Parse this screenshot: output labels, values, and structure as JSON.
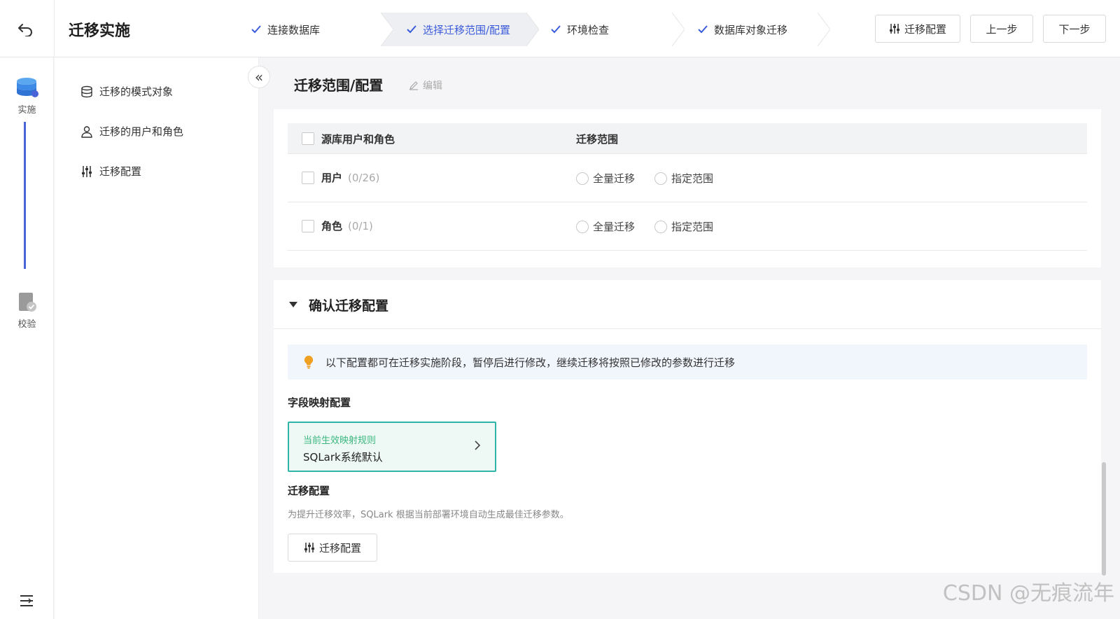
{
  "header": {
    "title": "迁移实施",
    "steps": [
      {
        "label": "连接数据库",
        "status": "done"
      },
      {
        "label": "选择迁移范围/配置",
        "status": "active"
      },
      {
        "label": "环境检查",
        "status": "done"
      },
      {
        "label": "数据库对象迁移",
        "status": "done"
      }
    ],
    "buttons": {
      "config": "迁移配置",
      "prev": "上一步",
      "next": "下一步"
    }
  },
  "rail": {
    "items": [
      {
        "label": "实施",
        "icon": "database-stack-icon"
      },
      {
        "label": "校验",
        "icon": "verify-doc-icon"
      }
    ]
  },
  "subnav": {
    "items": [
      {
        "label": "迁移的模式对象",
        "icon": "database-icon"
      },
      {
        "label": "迁移的用户和角色",
        "icon": "user-icon"
      },
      {
        "label": "迁移配置",
        "icon": "sliders-icon"
      }
    ]
  },
  "main": {
    "title": "迁移范围/配置",
    "edit_label": "编辑",
    "table": {
      "columns": [
        "源库用户和角色",
        "迁移范围"
      ],
      "rows": [
        {
          "label": "用户",
          "count": "(0/26)",
          "options": [
            "全量迁移",
            "指定范围"
          ]
        },
        {
          "label": "角色",
          "count": "(0/1)",
          "options": [
            "全量迁移",
            "指定范围"
          ]
        }
      ]
    },
    "confirm": {
      "title": "确认迁移配置",
      "notice": "以下配置都可在迁移实施阶段，暂停后进行修改，继续迁移将按照已修改的参数进行迁移",
      "mapping_label": "字段映射配置",
      "mapping_sub": "当前生效映射规则",
      "mapping_value": "SQLark系统默认",
      "migration_label": "迁移配置",
      "migration_desc": "为提升迁移效率，SQLark 根据当前部署环境自动生成最佳迁移参数。",
      "migration_button": "迁移配置"
    }
  },
  "watermark": "CSDN @无痕流年",
  "colors": {
    "accent": "#3b5bdb",
    "teal": "#2fb5a8",
    "green": "#3bb77e",
    "bulb": "#f0a020"
  }
}
